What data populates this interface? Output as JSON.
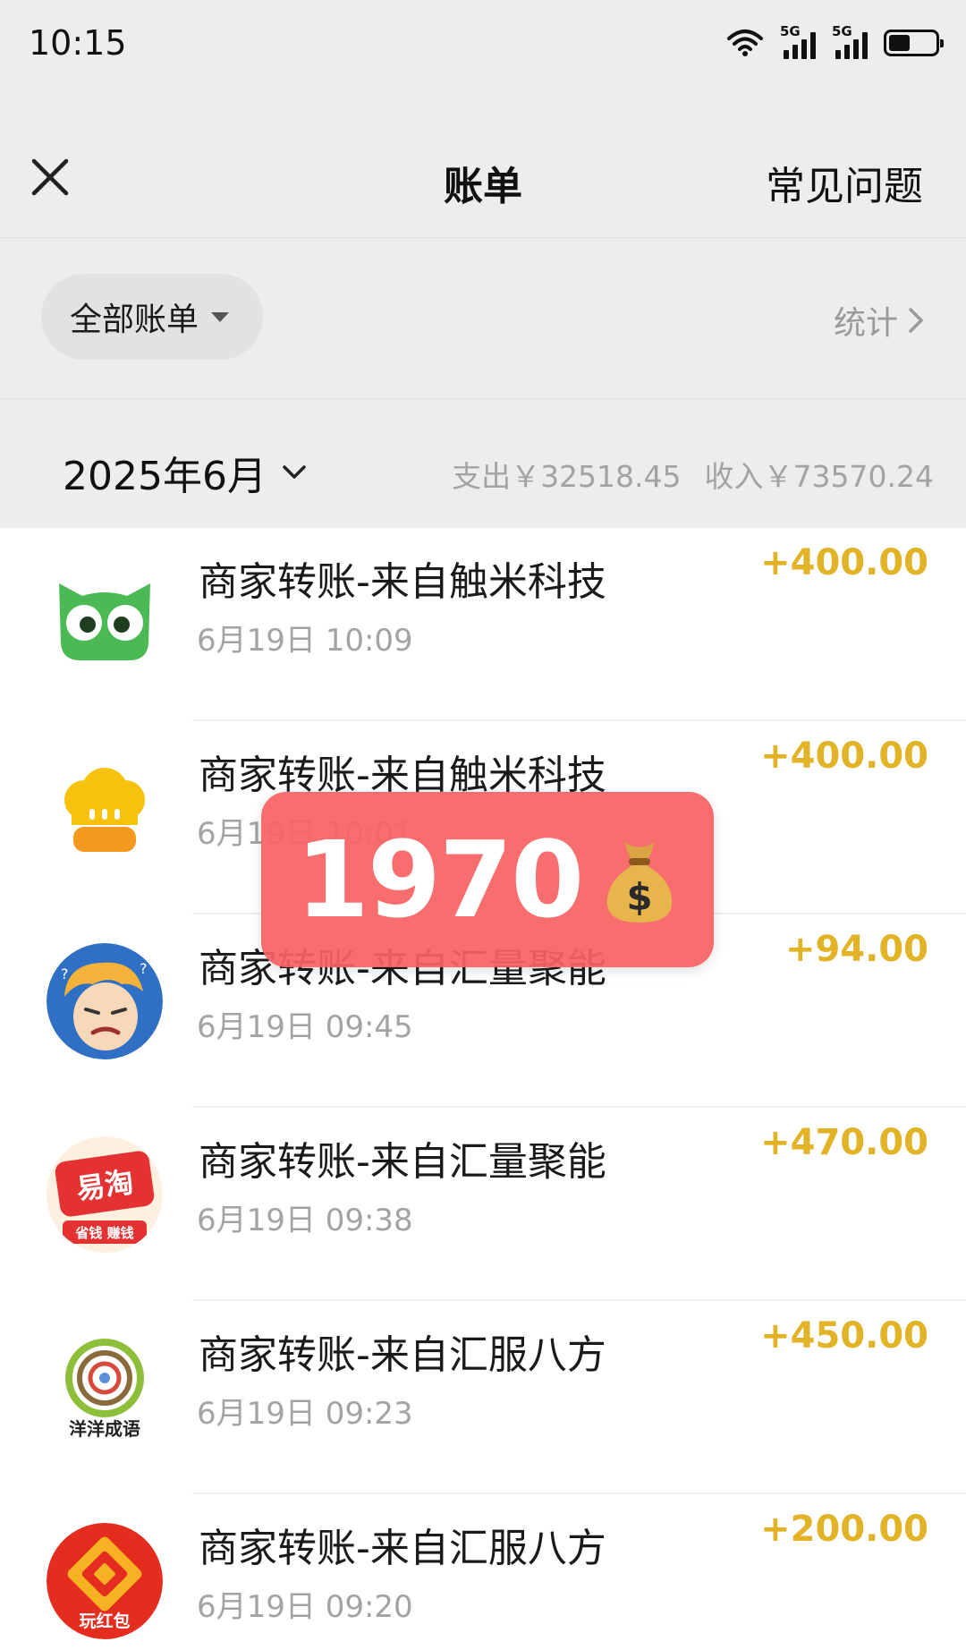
{
  "status_bar": {
    "time": "10:15",
    "signal_labels": [
      "5G",
      "5G"
    ],
    "icons": [
      "wifi-icon",
      "signal-icon",
      "signal-icon",
      "battery-icon"
    ]
  },
  "nav": {
    "title": "账单",
    "faq_label": "常见问题",
    "close_icon": "close-icon"
  },
  "filter": {
    "bill_filter_label": "全部账单",
    "stats_label": "统计"
  },
  "month": {
    "label": "2025年6月",
    "expense": "支出￥32518.45",
    "income": "收入￥73570.24"
  },
  "transactions": [
    {
      "name": "商家转账-来自触米科技",
      "time": "6月19日 10:09",
      "amount": "+400.00",
      "avatar_icon": "green-owl-icon"
    },
    {
      "name": "商家转账-来自触米科技",
      "time": "6月19日 10:01",
      "amount": "+400.00",
      "avatar_icon": "chef-hat-icon"
    },
    {
      "name": "商家转账-来自汇量聚能",
      "time": "6月19日 09:45",
      "amount": "+94.00",
      "avatar_icon": "cartoon-face-icon"
    },
    {
      "name": "商家转账-来自汇量聚能",
      "time": "6月19日 09:38",
      "amount": "+470.00",
      "avatar_icon": "yitao-logo-icon",
      "avatar_text": "易淘",
      "avatar_subtext": "省钱 赚钱"
    },
    {
      "name": "商家转账-来自汇服八方",
      "time": "6月19日 09:23",
      "amount": "+450.00",
      "avatar_icon": "idiom-game-icon",
      "avatar_text": "洋洋成语"
    },
    {
      "name": "商家转账-来自汇服八方",
      "time": "6月19日 09:20",
      "amount": "+200.00",
      "avatar_icon": "red-packet-icon",
      "avatar_text": "玩红包"
    }
  ],
  "overlay": {
    "value": "1970",
    "icon": "money-bag-icon"
  },
  "colors": {
    "header_bg": "#ededed",
    "amount": "#e2b227",
    "secondary_text": "#a3a3a3",
    "overlay_bg": "#f76262"
  }
}
